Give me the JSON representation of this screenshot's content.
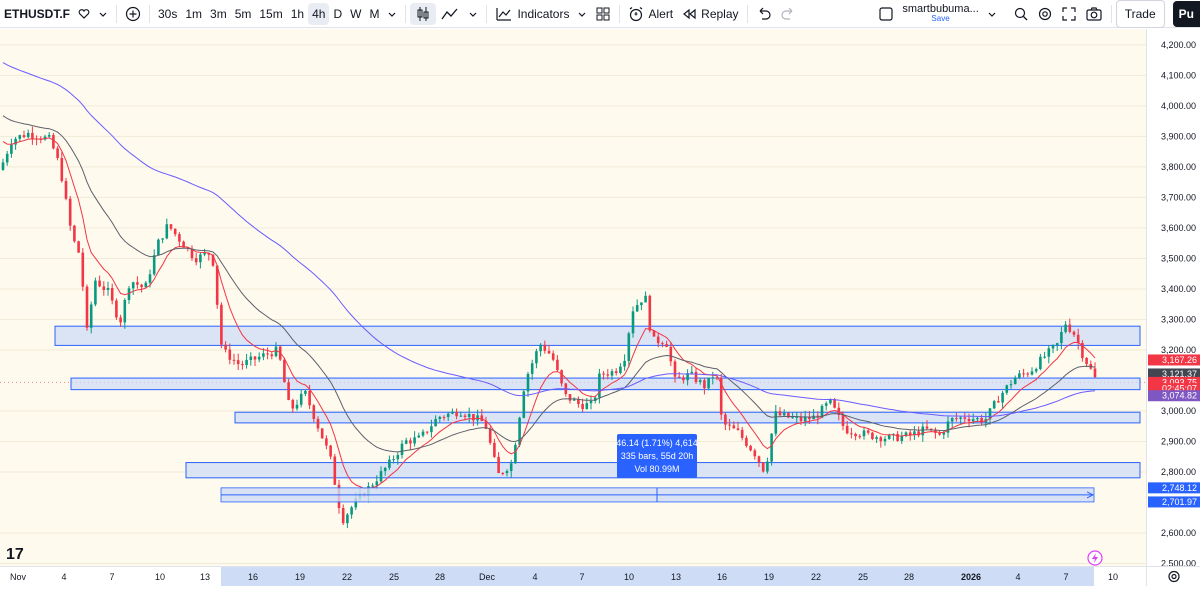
{
  "toolbar": {
    "symbol": "ETHUSDT.F",
    "timeframes": [
      "30s",
      "1m",
      "3m",
      "5m",
      "15m",
      "1h",
      "4h",
      "D",
      "W",
      "M"
    ],
    "active_timeframe": "4h",
    "indicators_label": "Indicators",
    "alert_label": "Alert",
    "replay_label": "Replay",
    "account_name": "smartbubuma...",
    "save_label": "Save",
    "trade_label": "Trade",
    "pu_label": "Pu"
  },
  "chart_data": {
    "type": "candlestick",
    "price_axis": {
      "ticks": [
        "4,200.00",
        "4,100.00",
        "4,000.00",
        "3,900.00",
        "3,800.00",
        "3,700.00",
        "3,600.00",
        "3,500.00",
        "3,400.00",
        "3,300.00",
        "3,200.00",
        "3,000.00",
        "2,900.00",
        "2,800.00",
        "2,600.00",
        "2,500.00"
      ],
      "tick_values": [
        4200,
        4100,
        4000,
        3900,
        3800,
        3700,
        3600,
        3500,
        3400,
        3300,
        3200,
        3000,
        2900,
        2800,
        2600,
        2500
      ],
      "range": [
        2492,
        4252
      ]
    },
    "price_labels": [
      {
        "text": "3,167.26",
        "value": 3167.26,
        "color": "#f23645"
      },
      {
        "text": "3,121.37",
        "value": 3121.37,
        "color": "#434651"
      },
      {
        "text": "3,093.75",
        "value": 3093.75,
        "color": "#f23645"
      },
      {
        "text": "02:45:07",
        "value": 3073,
        "color": "#f23645"
      },
      {
        "text": "3,074.82",
        "value": 3050,
        "color": "#7e57c2"
      },
      {
        "text": "2,748.12",
        "value": 2748.12,
        "color": "#2962ff"
      },
      {
        "text": "2,701.97",
        "value": 2701.97,
        "color": "#2962ff"
      }
    ],
    "time_axis": {
      "labels": [
        "Nov",
        "4",
        "7",
        "10",
        "13",
        "16",
        "19",
        "22",
        "25",
        "28",
        "Dec",
        "4",
        "7",
        "10",
        "13",
        "16",
        "19",
        "22",
        "25",
        "28",
        "2026",
        "4",
        "7",
        "10"
      ],
      "highlight_range": [
        "16",
        "7"
      ]
    },
    "zones": [
      {
        "top": 3278,
        "bottom": 3215
      },
      {
        "top": 3108,
        "bottom": 3070
      },
      {
        "top": 2996,
        "bottom": 2961
      },
      {
        "top": 2831,
        "bottom": 2781
      }
    ],
    "measure": {
      "top": 2748.12,
      "bottom": 2701.97,
      "lines": [
        "46.14 (1.71%) 4,614",
        "335 bars, 55d 20h",
        "Vol 80.99M"
      ]
    },
    "series": [
      {
        "name": "",
        "color": "#f23645",
        "kind": "ema-fast"
      },
      {
        "name": "",
        "color": "#5d606b",
        "kind": "ema-mid"
      },
      {
        "name": "",
        "color": "#6a5cff",
        "kind": "ema-slow"
      }
    ],
    "colors": {
      "up": "#089981",
      "down": "#f23645",
      "zone_fill": "#cfdcf5",
      "zone_border": "#2962ff",
      "background": "#fffaee"
    }
  }
}
